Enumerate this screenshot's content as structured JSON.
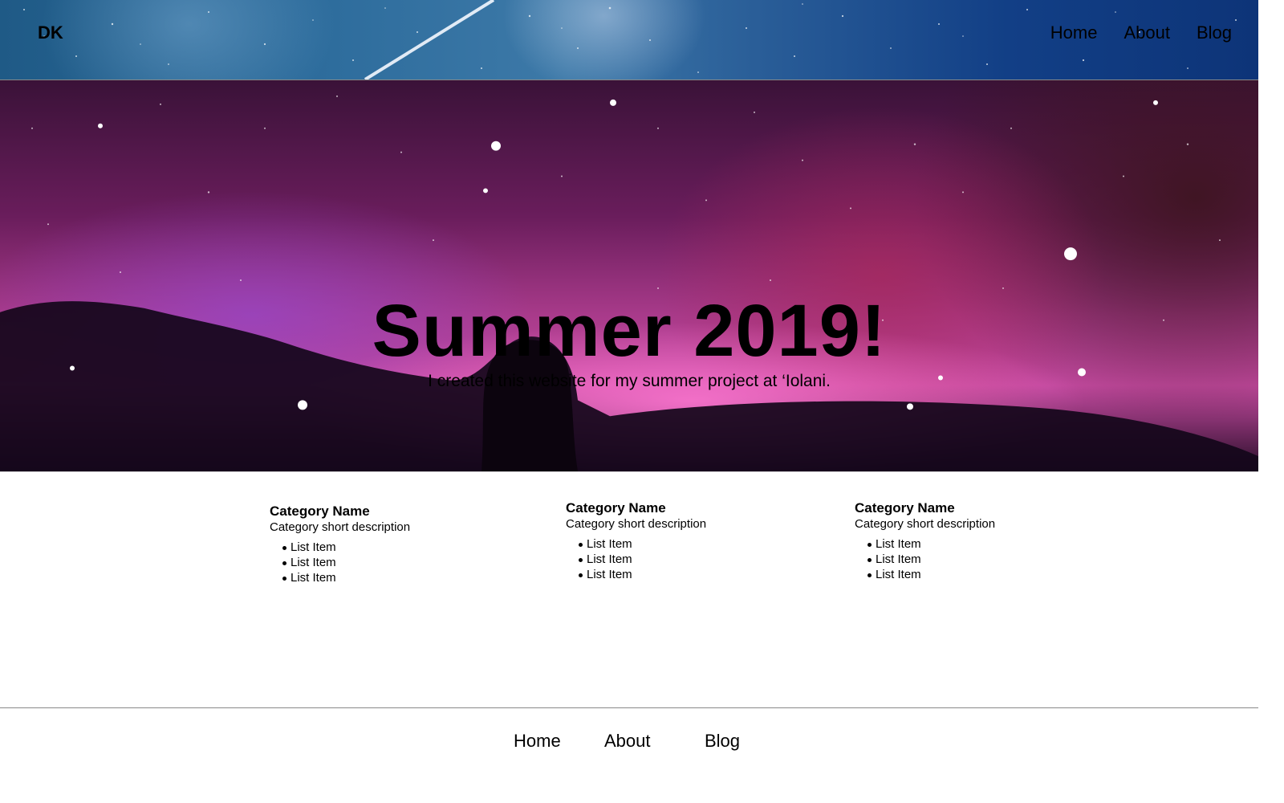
{
  "header": {
    "brand": "DK",
    "nav": [
      "Home",
      "About",
      "Blog"
    ]
  },
  "hero": {
    "title": "Summer 2019!",
    "subtitle": "I created this website for my summer project at ‘Iolani."
  },
  "categories": [
    {
      "name": "Category Name",
      "description": "Category short description",
      "items": [
        "List Item",
        "List Item",
        "List Item"
      ]
    },
    {
      "name": "Category Name",
      "description": "Category short description",
      "items": [
        "List Item",
        "List Item",
        "List Item"
      ]
    },
    {
      "name": "Category Name",
      "description": "Category short description",
      "items": [
        "List Item",
        "List Item",
        "List Item"
      ]
    }
  ],
  "footer": {
    "nav": [
      "Home",
      "About",
      "Blog"
    ]
  },
  "colors": {
    "header_bg": "#2d6c9c",
    "hero_accent": "#c44aa0",
    "text": "#000000",
    "divider": "#888888"
  }
}
